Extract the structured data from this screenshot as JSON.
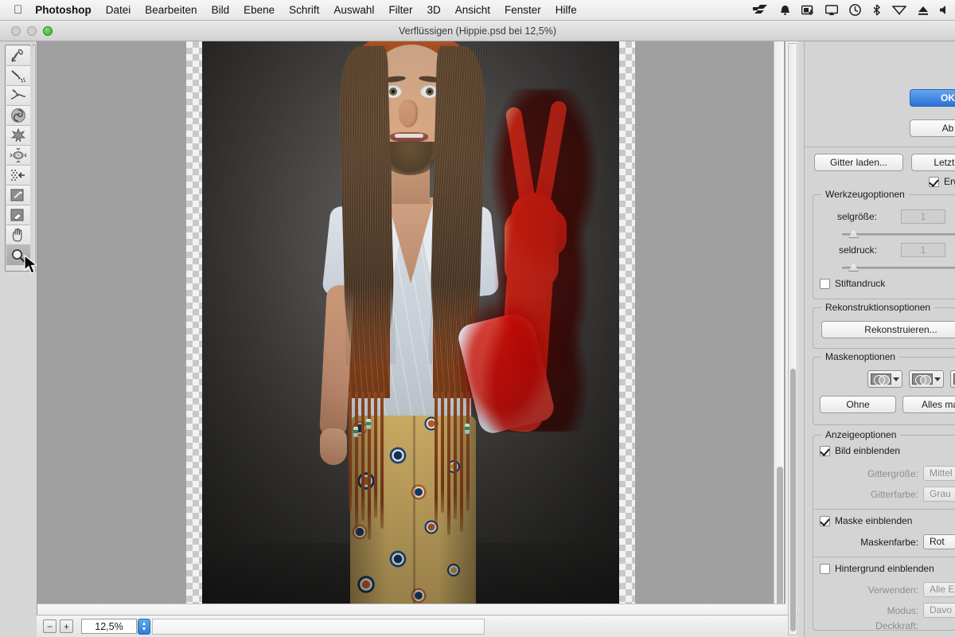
{
  "menubar": {
    "apple_icon": "apple-icon",
    "items": [
      {
        "label": "Photoshop",
        "bold": true
      },
      {
        "label": "Datei"
      },
      {
        "label": "Bearbeiten"
      },
      {
        "label": "Bild"
      },
      {
        "label": "Ebene"
      },
      {
        "label": "Schrift"
      },
      {
        "label": "Auswahl"
      },
      {
        "label": "Filter"
      },
      {
        "label": "3D"
      },
      {
        "label": "Ansicht"
      },
      {
        "label": "Fenster"
      },
      {
        "label": "Hilfe"
      }
    ],
    "status_icons": [
      "fast-forward-icon",
      "bell-icon",
      "screenshot-icon",
      "airplay-icon",
      "time-machine-icon",
      "bluetooth-icon",
      "wifi-icon",
      "eject-icon",
      "volume-icon"
    ]
  },
  "window": {
    "title": "Verflüssigen (Hippie.psd bei 12,5%)",
    "traffic_lights": [
      "close-button",
      "minimize-button",
      "zoom-button"
    ]
  },
  "toolbar": {
    "tools": [
      {
        "name": "forward-warp-tool",
        "selected": false
      },
      {
        "name": "reconstruct-tool",
        "selected": false
      },
      {
        "name": "smooth-tool",
        "selected": false
      },
      {
        "name": "twirl-clockwise-tool",
        "selected": false
      },
      {
        "name": "pucker-tool",
        "selected": false
      },
      {
        "name": "bloat-tool",
        "selected": false
      },
      {
        "name": "push-left-tool",
        "selected": false
      },
      {
        "name": "freeze-mask-tool",
        "selected": false
      },
      {
        "name": "thaw-mask-tool",
        "selected": false
      },
      {
        "name": "hand-tool",
        "selected": false
      },
      {
        "name": "zoom-tool",
        "selected": true
      }
    ]
  },
  "canvas": {
    "image_name": "Hippie.psd",
    "zoom": "12,5%",
    "mask_color": "#ed281c",
    "subject_description": "Junger Mann mit langen braunen Haaren, Stirnband, weißem Hemd, brauner Fransenweste und gemusterter Schlaghose; erhobener Arm mit Peace-Zeichen rot maskiert"
  },
  "statusbar": {
    "zoom_out_label": "−",
    "zoom_in_label": "+",
    "zoom_value": "12,5%",
    "stepper_up": "▲",
    "stepper_down": "▼"
  },
  "panel": {
    "ok_label": "OK",
    "cancel_label": "Ab",
    "load_grid_label": "Gitter laden...",
    "last_grid_label": "Letztes G",
    "advanced_label": "Erwe",
    "tool_options": {
      "legend": "Werkzeugoptionen",
      "brush_size_label": "selgröße:",
      "brush_size_value": "1",
      "brush_pressure_label": "seldruck:",
      "brush_pressure_value": "1",
      "pen_pressure_label": "Stiftandruck",
      "pen_pressure_checked": false
    },
    "reconstruct_options": {
      "legend": "Rekonstruktionsoptionen",
      "button_label": "Rekonstruieren..."
    },
    "mask_options": {
      "legend": "Maskenoptionen",
      "mode_icons": [
        "mask-replace-icon",
        "mask-add-icon",
        "mask-subtract-icon"
      ],
      "none_label": "Ohne",
      "mask_all_label": "Alles mas"
    },
    "view_options": {
      "legend": "Anzeigeoptionen",
      "show_image_label": "Bild einblenden",
      "show_image_checked": true,
      "grid_size_label": "Gittergröße:",
      "grid_size_value": "Mittel",
      "grid_color_label": "Gitterfarbe:",
      "grid_color_value": "Grau",
      "show_mask_label": "Maske einblenden",
      "show_mask_checked": true,
      "mask_color_label": "Maskenfarbe:",
      "mask_color_value": "Rot",
      "show_background_label": "Hintergrund einblenden",
      "show_background_checked": false,
      "use_label": "Verwenden:",
      "use_value": "Alle E",
      "mode_label": "Modus:",
      "mode_value": "Davo",
      "opacity_label": "Deckkraft:"
    }
  }
}
